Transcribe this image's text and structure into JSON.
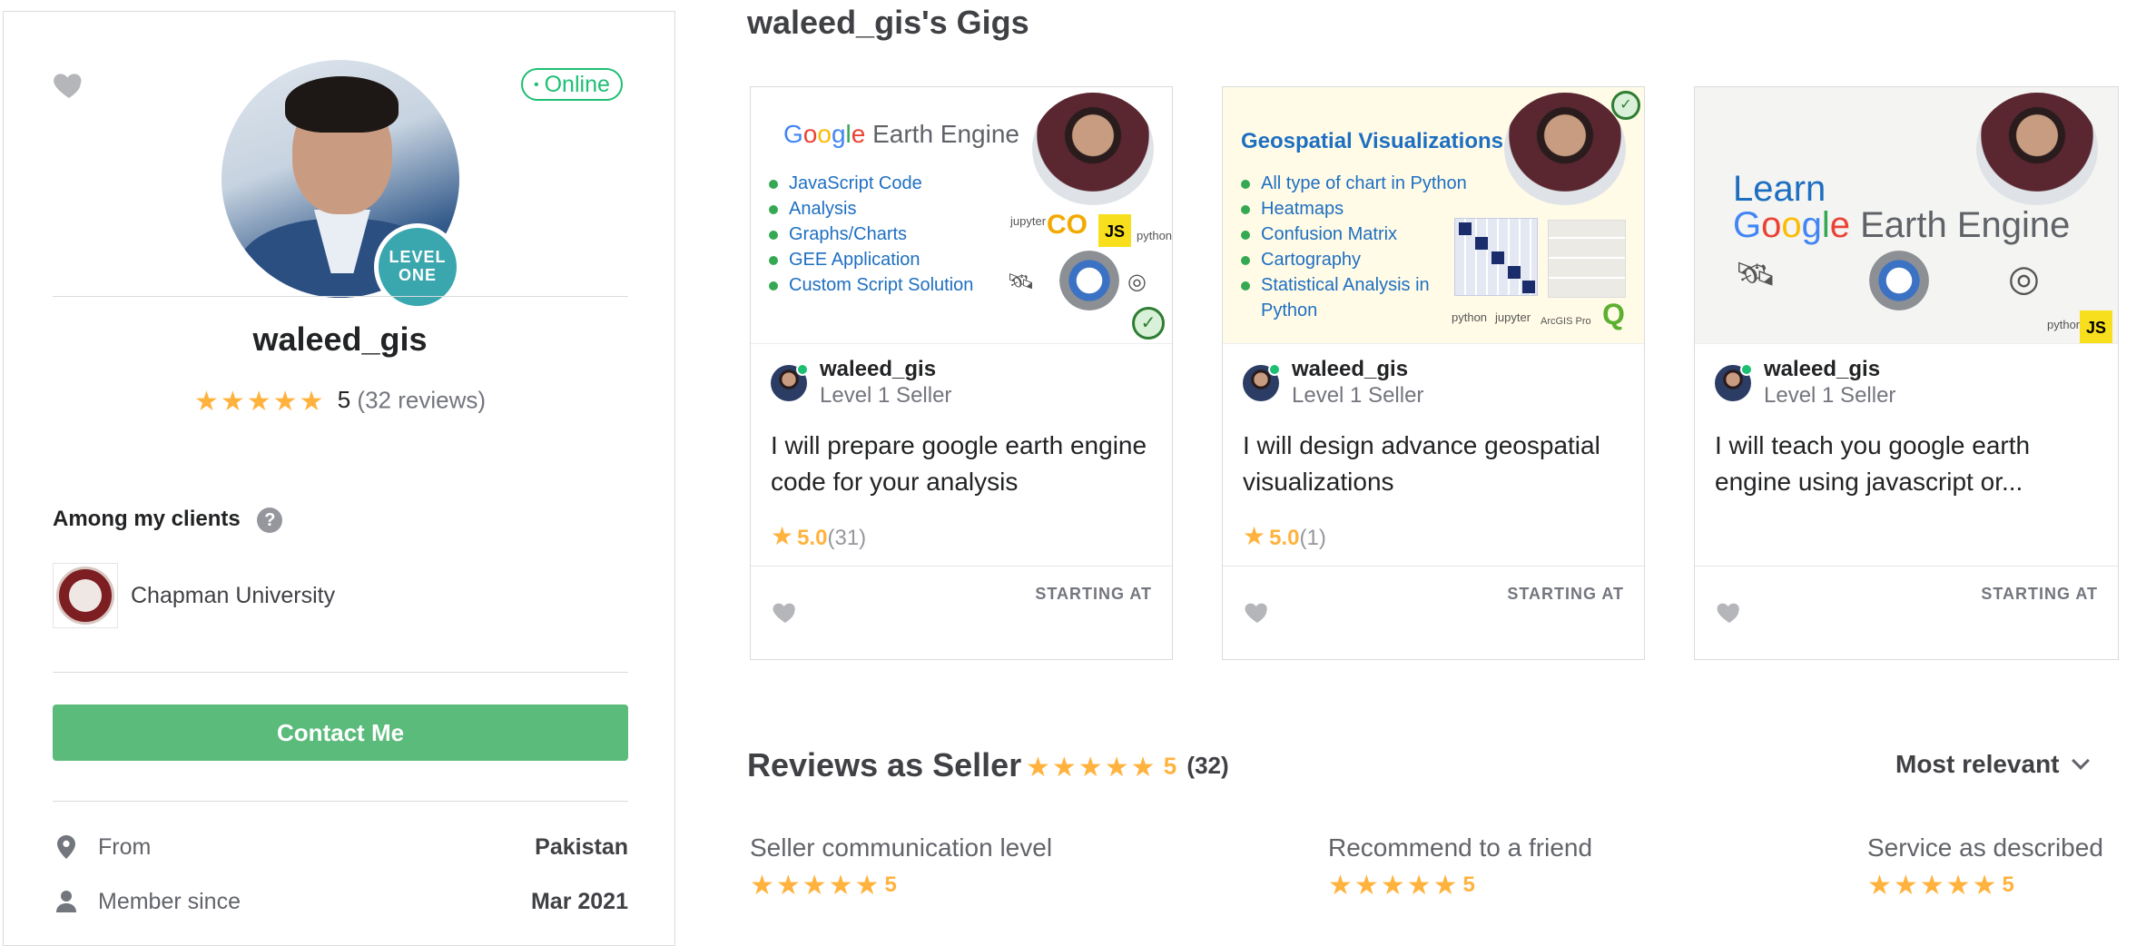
{
  "profile": {
    "status": "Online",
    "level_badge": "LEVEL ONE",
    "username": "waleed_gis",
    "stars": "★★★★★",
    "rating": "5",
    "reviews_text": "(32 reviews)",
    "clients_title": "Among my clients",
    "help_icon": "?",
    "clients": [
      {
        "name": "Chapman University",
        "logo_icon": "chapman-university-seal"
      }
    ],
    "contact_label": "Contact Me",
    "info": [
      {
        "icon": "location-pin-icon",
        "label": "From",
        "value": "Pakistan"
      },
      {
        "icon": "user-icon",
        "label": "Member since",
        "value": "Mar 2021"
      }
    ]
  },
  "gigs": {
    "heading": "waleed_gis's Gigs",
    "items": [
      {
        "thumb": {
          "title_parts": [
            "G",
            "o",
            "o",
            "g",
            "l",
            "e",
            " Earth Engine"
          ],
          "bullets": [
            "JavaScript Code",
            "Analysis",
            "Graphs/Charts",
            "GEE Application",
            "Custom Script Solution"
          ],
          "badges": {
            "jupyter": "jupyter",
            "co": "CO",
            "js": "JS",
            "python": "python"
          }
        },
        "seller_name": "waleed_gis",
        "seller_level": "Level 1 Seller",
        "title": "I will prepare google earth engine code for your analysis",
        "rating": "5.0",
        "rating_count": "(31)",
        "price_label": "STARTING AT"
      },
      {
        "thumb": {
          "title": "Geospatial Visualizations",
          "bullets": [
            "All type of chart in Python",
            "Heatmaps",
            "Confusion Matrix",
            "Cartography",
            "Statistical Analysis in Python"
          ],
          "badges": {
            "python": "python",
            "jupyter": "jupyter",
            "arcgis": "ArcGIS Pro"
          }
        },
        "seller_name": "waleed_gis",
        "seller_level": "Level 1 Seller",
        "title": "I will design advance geospatial visualizations",
        "rating": "5.0",
        "rating_count": "(1)",
        "price_label": "STARTING AT"
      },
      {
        "thumb": {
          "line1": "Learn",
          "line2_suffix": " Earth Engine",
          "badges": {
            "python": "python",
            "js": "JS"
          }
        },
        "seller_name": "waleed_gis",
        "seller_level": "Level 1 Seller",
        "title": "I will teach you google earth engine using javascript or...",
        "price_label": "STARTING AT"
      }
    ]
  },
  "reviews": {
    "heading": "Reviews as Seller",
    "stars": "★★★★★",
    "rating": "5",
    "count": "(32)",
    "sort_label": "Most relevant",
    "breakdown": [
      {
        "label": "Seller communication level",
        "value": "5"
      },
      {
        "label": "Recommend to a friend",
        "value": "5"
      },
      {
        "label": "Service as described",
        "value": "5"
      }
    ]
  },
  "colors": {
    "accent_green": "#1dbf73",
    "contact_button": "#5bbb7b",
    "star": "#ffb33e",
    "level_badge": "#3aa6ae"
  }
}
